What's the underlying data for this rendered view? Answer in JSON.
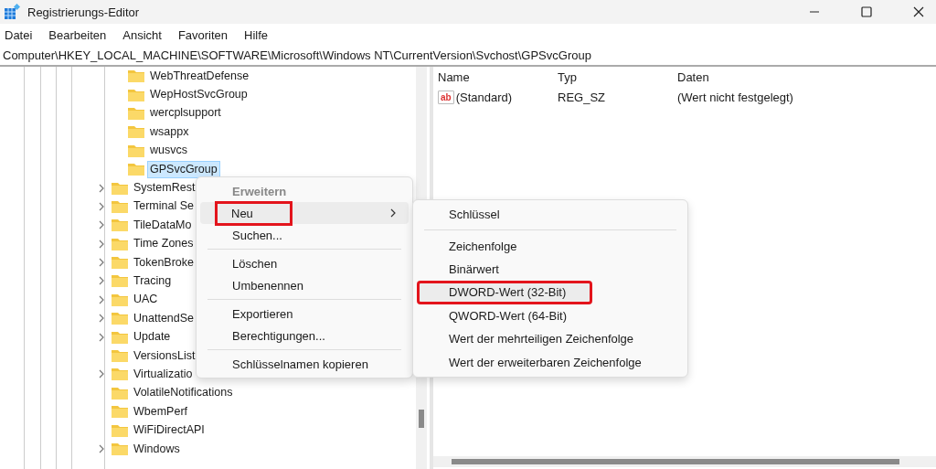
{
  "window": {
    "title": "Registrierungs-Editor"
  },
  "menu_bar": [
    "Datei",
    "Bearbeiten",
    "Ansicht",
    "Favoriten",
    "Hilfe"
  ],
  "address_bar": "Computer\\HKEY_LOCAL_MACHINE\\SOFTWARE\\Microsoft\\Windows NT\\CurrentVersion\\Svchost\\GPSvcGroup",
  "tree": {
    "subkeys": [
      {
        "label": "WebThreatDefense",
        "selected": false
      },
      {
        "label": "WepHostSvcGroup",
        "selected": false
      },
      {
        "label": "wercplsupport",
        "selected": false
      },
      {
        "label": "wsappx",
        "selected": false
      },
      {
        "label": "wusvcs",
        "selected": false
      },
      {
        "label": "GPSvcGroup",
        "selected": true
      }
    ],
    "keys": [
      {
        "label": "SystemRest",
        "expandable": true
      },
      {
        "label": "Terminal Se",
        "expandable": true
      },
      {
        "label": "TileDataMo",
        "expandable": true
      },
      {
        "label": "Time Zones",
        "expandable": true
      },
      {
        "label": "TokenBroke",
        "expandable": true
      },
      {
        "label": "Tracing",
        "expandable": true
      },
      {
        "label": "UAC",
        "expandable": true
      },
      {
        "label": "UnattendSe",
        "expandable": true
      },
      {
        "label": "Update",
        "expandable": true
      },
      {
        "label": "VersionsList",
        "expandable": false
      },
      {
        "label": "Virtualizatio",
        "expandable": true
      },
      {
        "label": "VolatileNotifications",
        "expandable": false
      },
      {
        "label": "WbemPerf",
        "expandable": false
      },
      {
        "label": "WiFiDirectAPI",
        "expandable": false
      },
      {
        "label": "Windows",
        "expandable": true
      }
    ]
  },
  "values_table": {
    "columns": [
      "Name",
      "Typ",
      "Daten"
    ],
    "rows": [
      {
        "icon_text": "ab",
        "name": "(Standard)",
        "type": "REG_SZ",
        "data": "(Wert nicht festgelegt)"
      }
    ]
  },
  "context_menu": [
    {
      "kind": "header",
      "label": "Erweitern"
    },
    {
      "kind": "submenu",
      "label": "Neu",
      "selected": true,
      "annotated": true
    },
    {
      "kind": "item",
      "label": "Suchen..."
    },
    {
      "kind": "separator"
    },
    {
      "kind": "item",
      "label": "Löschen"
    },
    {
      "kind": "item",
      "label": "Umbenennen"
    },
    {
      "kind": "separator"
    },
    {
      "kind": "item",
      "label": "Exportieren"
    },
    {
      "kind": "item",
      "label": "Berechtigungen..."
    },
    {
      "kind": "separator"
    },
    {
      "kind": "item",
      "label": "Schlüsselnamen kopieren"
    }
  ],
  "submenu": [
    {
      "kind": "item",
      "label": "Schlüssel",
      "selected": false,
      "annotated": false
    },
    {
      "kind": "separator"
    },
    {
      "kind": "item",
      "label": "Zeichenfolge",
      "selected": false,
      "annotated": false
    },
    {
      "kind": "item",
      "label": "Binärwert",
      "selected": false,
      "annotated": false
    },
    {
      "kind": "item",
      "label": "DWORD-Wert (32-Bit)",
      "selected": true,
      "annotated": true
    },
    {
      "kind": "item",
      "label": "QWORD-Wert (64-Bit)",
      "selected": false,
      "annotated": false
    },
    {
      "kind": "item",
      "label": "Wert der mehrteiligen Zeichenfolge",
      "selected": false,
      "annotated": false
    },
    {
      "kind": "item",
      "label": "Wert der erweiterbaren Zeichenfolge",
      "selected": false,
      "annotated": false
    }
  ]
}
